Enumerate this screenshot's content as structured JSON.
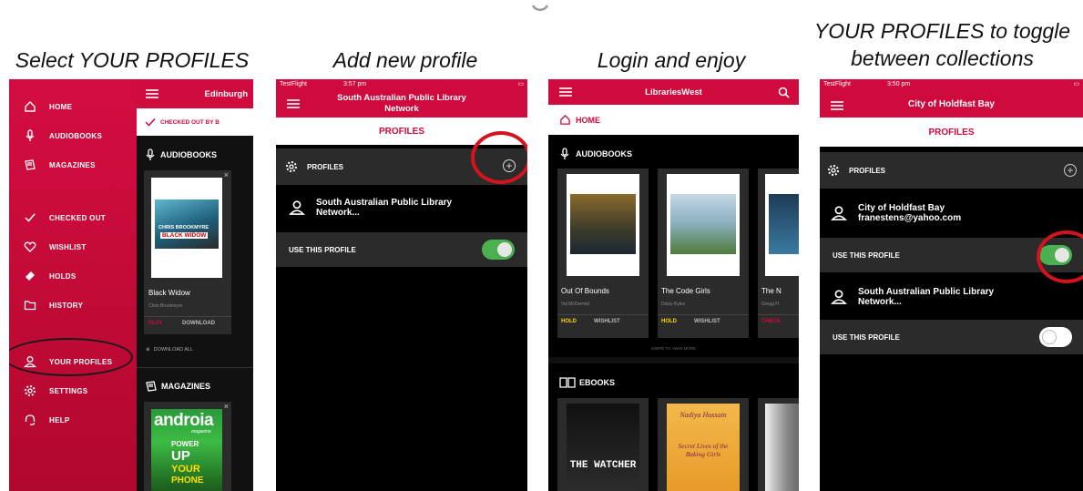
{
  "spinner_icon": "loading-spinner-icon",
  "captions": {
    "c1": "Select YOUR PROFILES",
    "c2": "Add new profile",
    "c3": "Login and enjoy",
    "c4_line1": "YOUR PROFILES to toggle",
    "c4_line2": "between collections"
  },
  "colors": {
    "brand_red": "#cf0a3c",
    "dark": "#2b2b2b",
    "toggle_on": "#4caf50",
    "annotation_red": "#d3131f"
  },
  "panel1": {
    "menu": {
      "home": "HOME",
      "audiobooks": "AUDIOBOOKS",
      "magazines": "MAGAZINES",
      "checked_out": "CHECKED OUT",
      "wishlist": "WISHLIST",
      "holds": "HOLDS",
      "history": "HISTORY",
      "your_profiles": "YOUR PROFILES",
      "settings": "SETTINGS",
      "help": "HELP"
    },
    "library_name": "Edinburgh",
    "checked_out_by": "CHECKED OUT BY B",
    "audiobooks_header": "AUDIOBOOKS",
    "book": {
      "cover_author": "CHRIS BROOKMYRE",
      "cover_title": "BLACK WIDOW",
      "title": "Black Widow",
      "author": "Chris Brookmyre",
      "play": "PLAY",
      "download": "DOWNLOAD"
    },
    "download_all": "DOWNLOAD ALL",
    "magazines_header": "MAGAZINES",
    "magazine": {
      "name": "androia",
      "tag": "magazine",
      "line1": "POWER",
      "line2": "UP",
      "line3": "YOUR",
      "line4": "PHONE"
    }
  },
  "panel2": {
    "status": {
      "carrier": "TestFlight",
      "time": "3:57 pm"
    },
    "title_line1": "South Australian Public Library",
    "title_line2": "Network",
    "section_title": "PROFILES",
    "profiles_label": "PROFILES",
    "profile_name_line1": "South Australian Public Library",
    "profile_name_line2": "Network...",
    "use_this_profile": "USE THIS PROFILE",
    "toggle_on": true
  },
  "panel3": {
    "title": "LibrariesWest",
    "home": "HOME",
    "audiobooks_header": "AUDIOBOOKS",
    "books": [
      {
        "title": "Out Of Bounds",
        "author": "Val McDermid",
        "action1": "HOLD",
        "action2": "WISHLIST"
      },
      {
        "title": "The Code Girls",
        "author": "Daisy Kyles",
        "action1": "HOLD",
        "action2": "WISHLIST"
      },
      {
        "title": "The N",
        "author": "Gregg H",
        "action1": "CHECK"
      }
    ],
    "swipe_hint": "SWIPE TO VIEW MORE",
    "ebooks_header": "EBOOKS",
    "ebook1_title": "THE WATCHER",
    "ebook2_author": "Nadiya Hussain",
    "ebook2_title": "Secret Lives of the Baking Girls"
  },
  "panel4": {
    "status": {
      "carrier": "TestFlight",
      "time": "3:50 pm"
    },
    "title": "City of Holdfast Bay",
    "section_title": "PROFILES",
    "profiles_label": "PROFILES",
    "profile1_name": "City of Holdfast Bay",
    "profile1_email": "franestens@yahoo.com",
    "use_this_profile_1": "USE THIS PROFILE",
    "toggle1_on": true,
    "profile2_line1": "South Australian Public Library",
    "profile2_line2": "Network...",
    "use_this_profile_2": "USE THIS PROFILE",
    "toggle2_on": false
  }
}
